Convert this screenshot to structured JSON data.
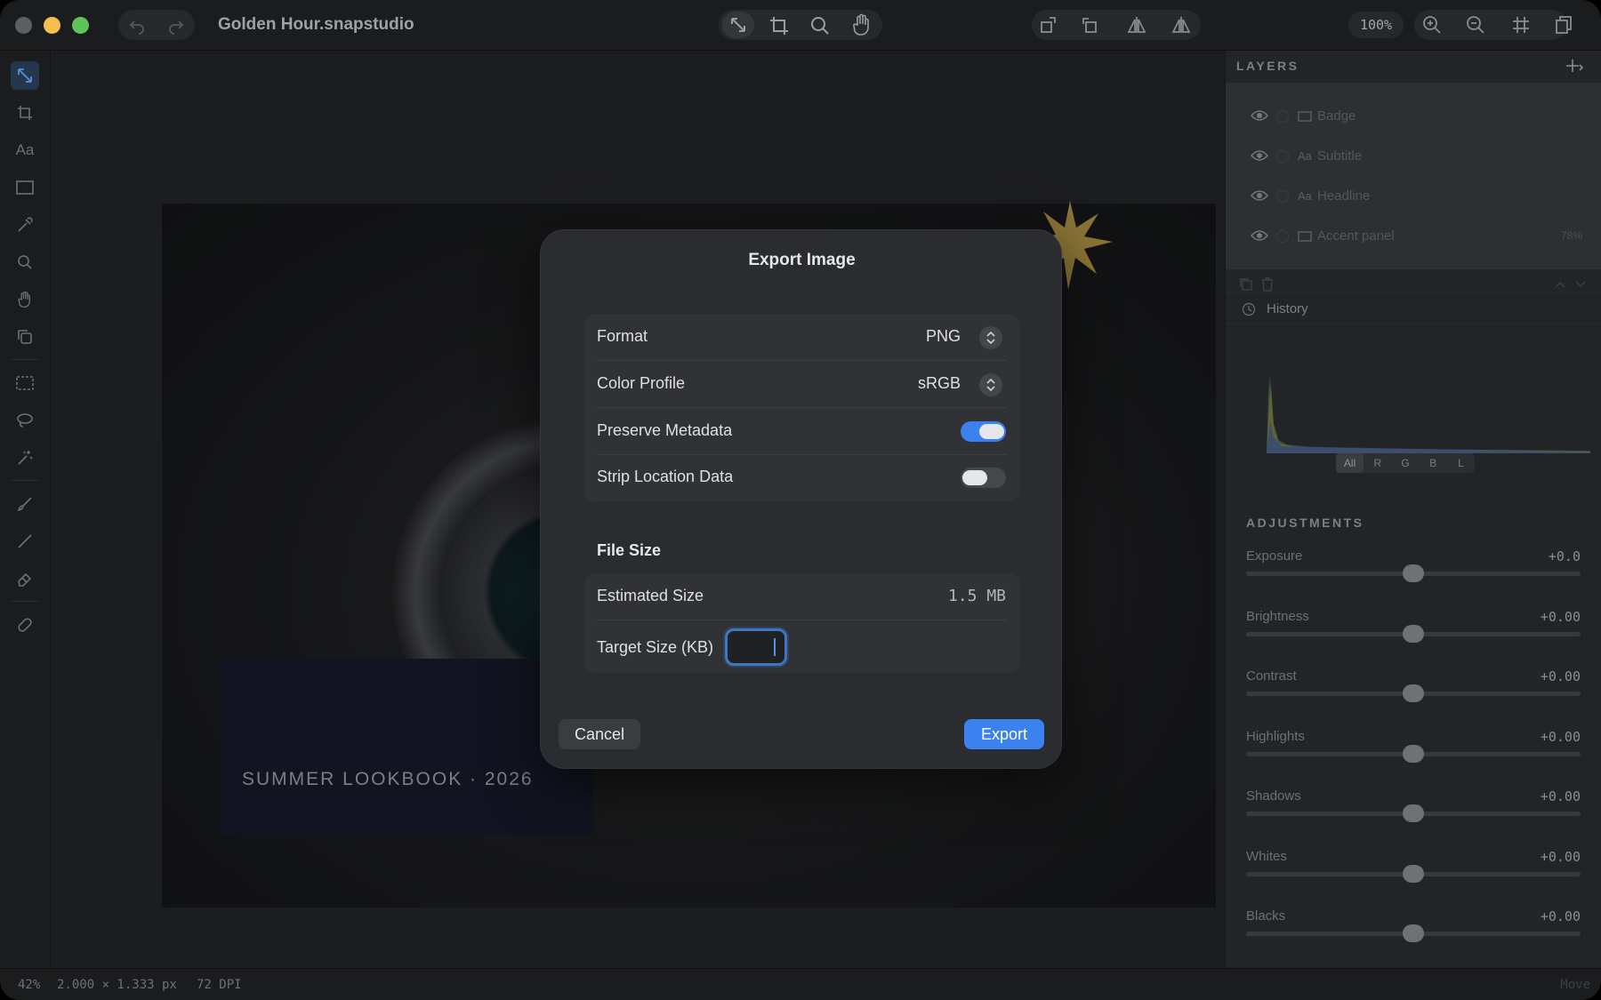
{
  "window": {
    "title": "Golden Hour.snapstudio",
    "zoom_label": "100%"
  },
  "canvas": {
    "artwork_text": "SUMMER LOOKBOOK · 2026"
  },
  "layers_panel": {
    "title": "LAYERS",
    "layers": [
      {
        "name": "Badge",
        "kind": "",
        "opacity": ""
      },
      {
        "name": "Subtitle",
        "kind": "Aa",
        "opacity": ""
      },
      {
        "name": "Headline",
        "kind": "Aa",
        "opacity": ""
      },
      {
        "name": "Accent panel",
        "kind": "",
        "opacity": "78%"
      }
    ]
  },
  "history": {
    "title": "History",
    "tabs": [
      "All",
      "R",
      "G",
      "B",
      "L"
    ],
    "active_tab": "All"
  },
  "adjustments": {
    "title": "ADJUSTMENTS",
    "items": [
      {
        "label": "Exposure",
        "value": "+0.0",
        "level": 0.5
      },
      {
        "label": "Brightness",
        "value": "+0.00",
        "level": 0.5
      },
      {
        "label": "Contrast",
        "value": "+0.00",
        "level": 0.5
      },
      {
        "label": "Highlights",
        "value": "+0.00",
        "level": 0.5
      },
      {
        "label": "Shadows",
        "value": "+0.00",
        "level": 0.5
      },
      {
        "label": "Whites",
        "value": "+0.00",
        "level": 0.5
      },
      {
        "label": "Blacks",
        "value": "+0.00",
        "level": 0.5
      }
    ]
  },
  "status": {
    "zoom": "42%",
    "dimensions": "2.000 × 1.333 px",
    "dpi": "72 DPI",
    "tool": "Move"
  },
  "dialog": {
    "title": "Export Image",
    "format_label": "Format",
    "format_value": "PNG",
    "color_profile_label": "Color Profile",
    "color_profile_value": "sRGB",
    "preserve_metadata_label": "Preserve Metadata",
    "preserve_metadata_on": true,
    "strip_location_label": "Strip Location Data",
    "strip_location_on": false,
    "file_size_heading": "File Size",
    "estimated_size_label": "Estimated Size",
    "estimated_size_value": "1.5 MB",
    "target_size_label": "Target Size (KB)",
    "target_size_value": "",
    "cancel_label": "Cancel",
    "export_label": "Export"
  },
  "colors": {
    "accent": "#3b82f0",
    "badge_gold": "#8a7336"
  }
}
